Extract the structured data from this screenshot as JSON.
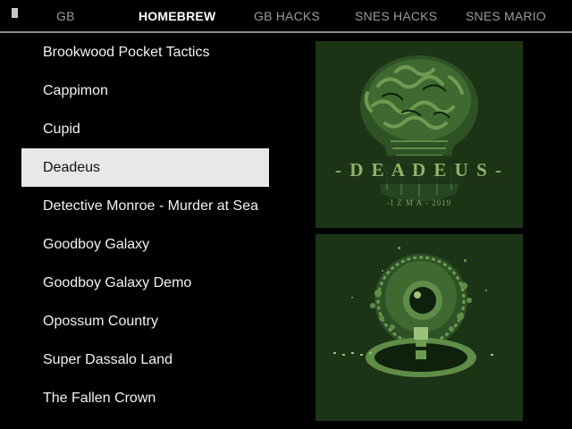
{
  "header": {
    "tabs": [
      {
        "label": "GB"
      },
      {
        "label": "HOMEBREW"
      },
      {
        "label": "GB HACKS"
      },
      {
        "label": "SNES HACKS"
      },
      {
        "label": "SNES MARIO"
      }
    ],
    "active_tab": "HOMEBREW"
  },
  "games": [
    {
      "title": "Brookwood Pocket Tactics"
    },
    {
      "title": "Cappimon"
    },
    {
      "title": "Cupid"
    },
    {
      "title": "Deadeus"
    },
    {
      "title": "Detective Monroe - Murder at Sea"
    },
    {
      "title": "Goodboy Galaxy"
    },
    {
      "title": "Goodboy Galaxy Demo"
    },
    {
      "title": "Opossum Country"
    },
    {
      "title": "Super Dassalo Land"
    },
    {
      "title": "The Fallen Crown"
    }
  ],
  "selected_game": "Deadeus",
  "preview": {
    "title_art": {
      "logo_text": "- D E A D E U S -",
      "credit_text": "-I Z M A - 2019"
    },
    "screenshot": {}
  },
  "colors": {
    "background": "#000000",
    "selection_bg": "#e6e8ea",
    "gb_darkest": "#0f200c",
    "gb_dark": "#2e5226",
    "gb_light": "#5f8d47",
    "gb_lightest": "#9cc27a"
  }
}
